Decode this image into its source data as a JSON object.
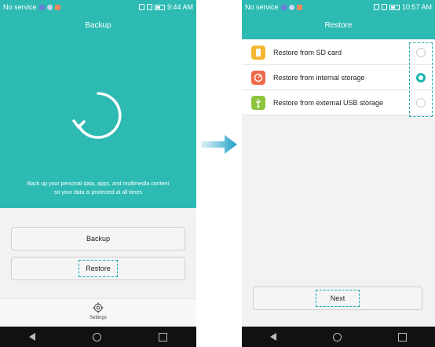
{
  "left_screen": {
    "status_bar": {
      "carrier": "No service",
      "time": "9:44 AM"
    },
    "title": "Backup",
    "description_line1": "Back up your personal data, apps, and multimedia content",
    "description_line2": "so your data is protected at all times",
    "buttons": {
      "backup": "Backup",
      "restore": "Restore"
    },
    "settings_label": "Settings"
  },
  "right_screen": {
    "status_bar": {
      "carrier": "No service",
      "time": "10:57 AM"
    },
    "title": "Restore",
    "options": [
      {
        "label": "Restore from SD card",
        "icon": "sd-card-icon",
        "color": "#f5b731",
        "selected": false
      },
      {
        "label": "Restore from internal storage",
        "icon": "storage-icon",
        "color": "#ee6b4a",
        "selected": true
      },
      {
        "label": "Restore from external USB storage",
        "icon": "usb-icon",
        "color": "#8cc43d",
        "selected": false
      }
    ],
    "next_label": "Next"
  },
  "colors": {
    "accent": "#2dbab3",
    "highlight": "#1aa6b0",
    "nav_bar": "#111111"
  }
}
